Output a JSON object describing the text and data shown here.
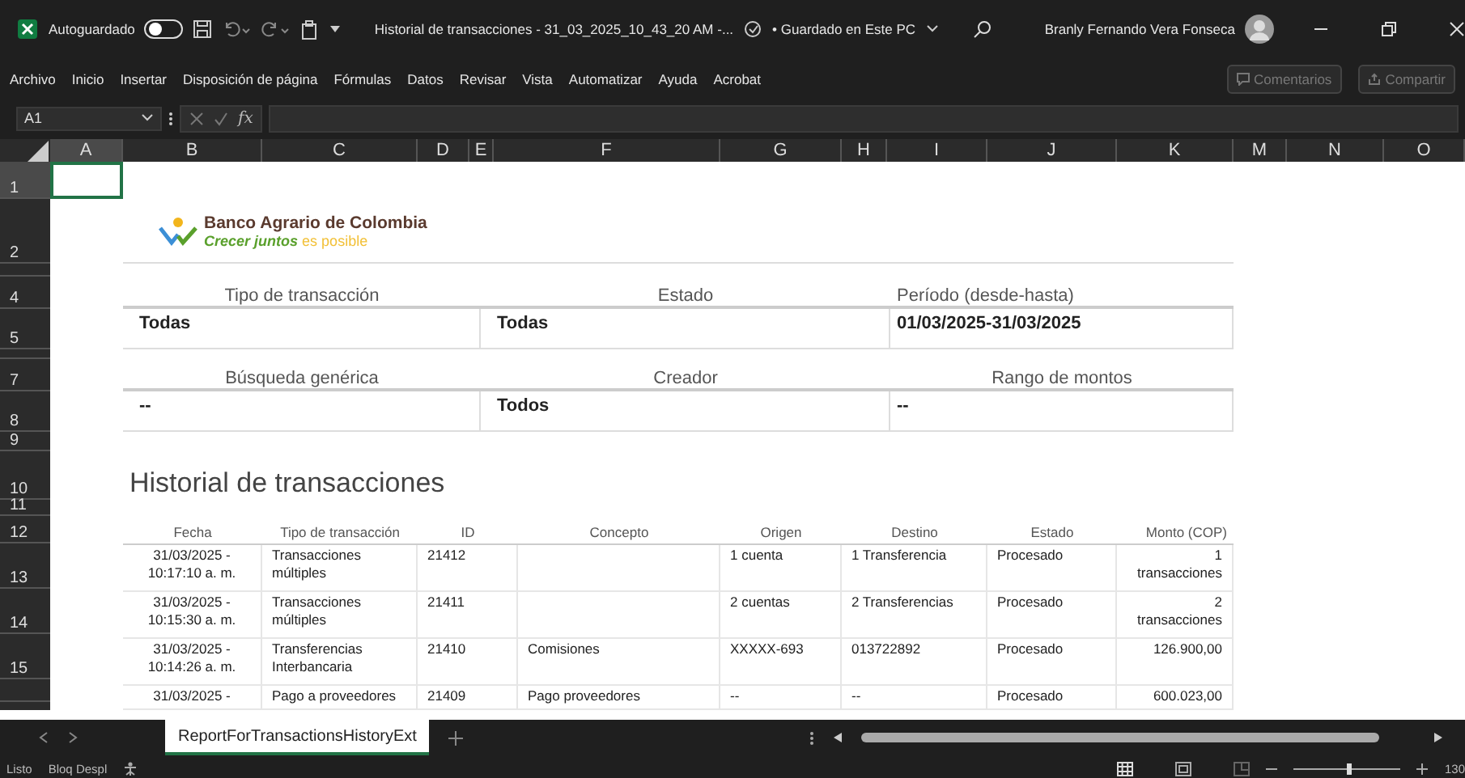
{
  "title_bar": {
    "autosave_label": "Autoguardado",
    "autosave_on": false,
    "document_title": "Historial de transacciones - 31_03_2025_10_43_20 AM -...",
    "save_status": "• Guardado en Este PC",
    "user_name": "Branly Fernando Vera Fonseca"
  },
  "menu": [
    "Archivo",
    "Inicio",
    "Insertar",
    "Disposición de página",
    "Fórmulas",
    "Datos",
    "Revisar",
    "Vista",
    "Automatizar",
    "Ayuda",
    "Acrobat"
  ],
  "ribbon_buttons": [
    {
      "label": "Comentarios",
      "disabled": true
    },
    {
      "label": "Compartir",
      "disabled": true
    }
  ],
  "formula_bar": {
    "name_box": "A1",
    "function_label": "fx"
  },
  "columns": [
    {
      "label": "A",
      "selected": true
    },
    {
      "label": "B",
      "selected": false
    },
    {
      "label": "C",
      "selected": false
    },
    {
      "label": "D",
      "selected": false
    },
    {
      "label": "E",
      "selected": false
    },
    {
      "label": "F",
      "selected": false
    },
    {
      "label": "G",
      "selected": false
    },
    {
      "label": "H",
      "selected": false
    },
    {
      "label": "I",
      "selected": false
    },
    {
      "label": "J",
      "selected": false
    },
    {
      "label": "K",
      "selected": false
    },
    {
      "label": "M",
      "selected": false
    },
    {
      "label": "N",
      "selected": false
    },
    {
      "label": "O",
      "selected": false
    }
  ],
  "row_headers": [
    {
      "label": "1",
      "selected": true
    },
    {
      "label": "2",
      "selected": false
    },
    {
      "label": "4",
      "selected": false
    },
    {
      "label": "5",
      "selected": false
    },
    {
      "label": "7",
      "selected": false
    },
    {
      "label": "8",
      "selected": false
    },
    {
      "label": "9",
      "selected": false
    },
    {
      "label": "10",
      "selected": false
    },
    {
      "label": "11",
      "selected": false
    },
    {
      "label": "12",
      "selected": false
    },
    {
      "label": "13",
      "selected": false
    },
    {
      "label": "14",
      "selected": false
    },
    {
      "label": "15",
      "selected": false
    }
  ],
  "logo": {
    "name": "Banco Agrario de Colombia",
    "tagline_strong": "Crecer juntos",
    "tagline_rest": "es posible"
  },
  "filters": [
    {
      "label": "Tipo de transacción",
      "value": "Todas"
    },
    {
      "label": "Estado",
      "value": "Todas"
    },
    {
      "label": "Período (desde-hasta)",
      "value": "01/03/2025-31/03/2025"
    },
    {
      "label": "Búsqueda genérica",
      "value": "--"
    },
    {
      "label": "Creador",
      "value": "Todos"
    },
    {
      "label": "Rango de montos",
      "value": "--"
    }
  ],
  "report_title": "Historial de transacciones",
  "table": {
    "columns": [
      "Fecha",
      "Tipo de transacción",
      "ID",
      "Concepto",
      "Origen",
      "Destino",
      "Estado",
      "Monto (COP)"
    ],
    "rows": [
      [
        "31/03/2025 - 10:17:10 a. m.",
        "Transacciones múltiples",
        "21412",
        "",
        "1 cuenta",
        "1 Transferencia",
        "Procesado",
        "1 transacciones"
      ],
      [
        "31/03/2025 - 10:15:30 a. m.",
        "Transacciones múltiples",
        "21411",
        "",
        "2 cuentas",
        "2 Transferencias",
        "Procesado",
        "2 transacciones"
      ],
      [
        "31/03/2025 - 10:14:26 a. m.",
        "Transferencias Interbancaria",
        "21410",
        "Comisiones",
        "XXXXX-693",
        "013722892",
        "Procesado",
        "126.900,00"
      ],
      [
        "31/03/2025 -",
        "Pago a proveedores",
        "21409",
        "Pago proveedores",
        "--",
        "--",
        "Procesado",
        "600.023,00"
      ]
    ]
  },
  "sheet_tabs": [
    {
      "label": "ReportForTransactionsHistoryExt",
      "selected": true
    }
  ],
  "status_bar": {
    "items": [
      "Listo",
      "Bloq Despl"
    ],
    "zoom_slider": {
      "level": 0.5
    },
    "zoom": "130"
  }
}
